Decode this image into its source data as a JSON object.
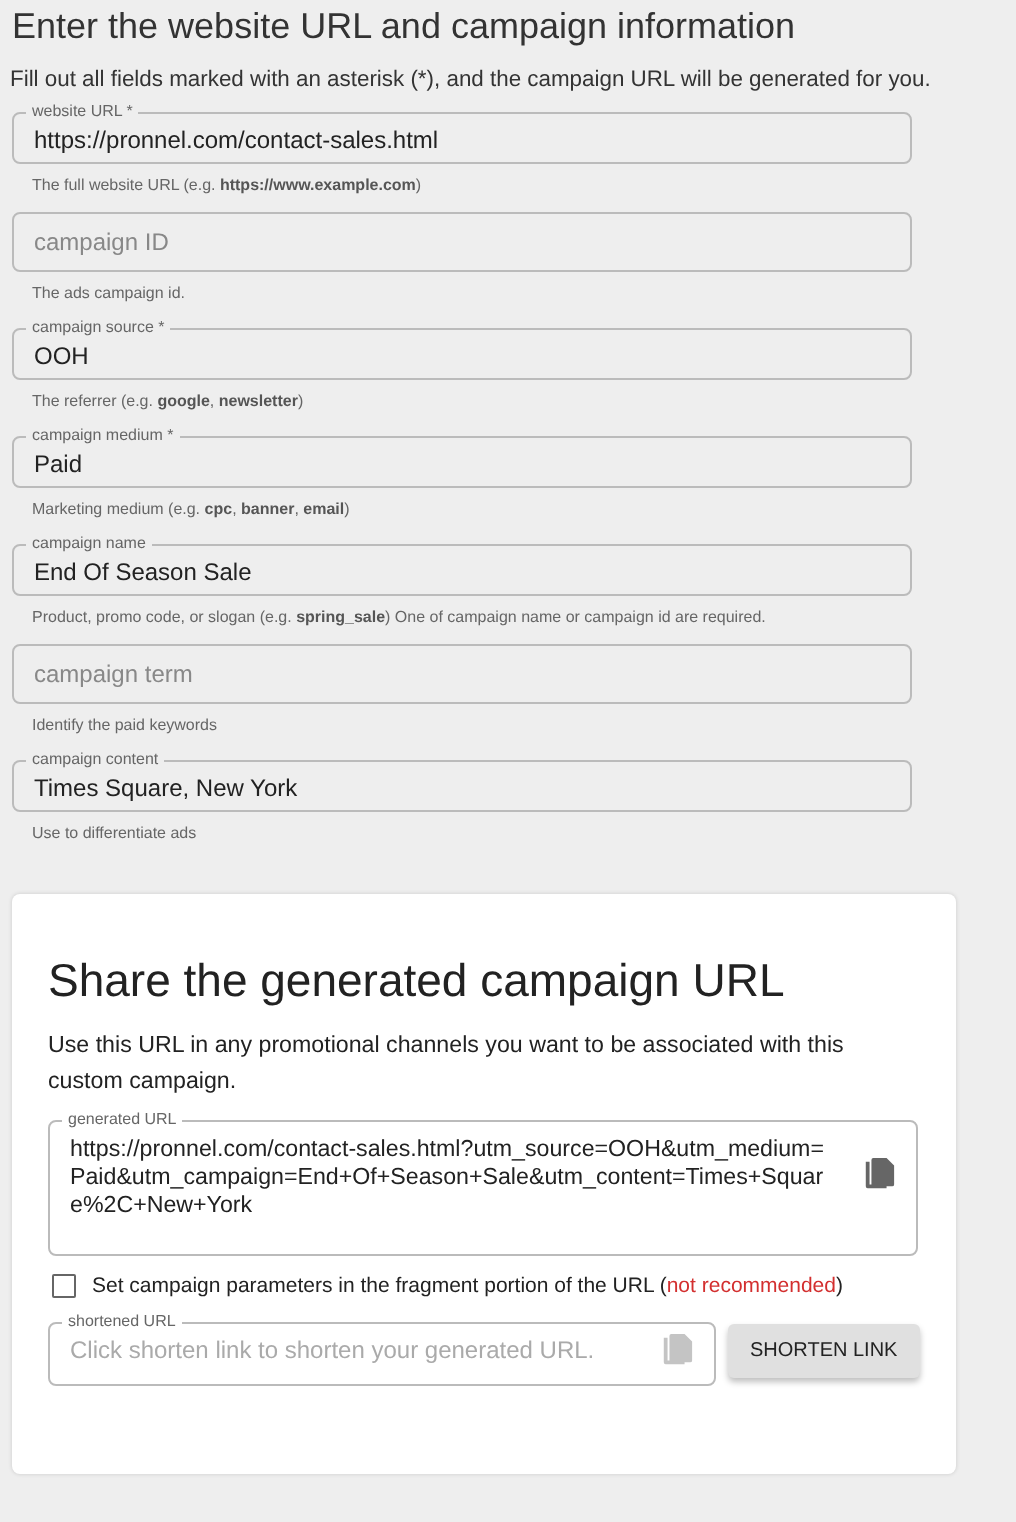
{
  "heading": "Enter the website URL and campaign information",
  "intro": "Fill out all fields marked with an asterisk (*), and the campaign URL will be generated for you.",
  "fields": [
    {
      "label": "website URL *",
      "value": "https://pronnel.com/contact-sales.html",
      "helper": "The full website URL (e.g. **https://www.example.com**)"
    },
    {
      "placeholder": "campaign ID",
      "helper": "The ads campaign id."
    },
    {
      "label": "campaign source *",
      "value": "OOH",
      "helper": "The referrer (e.g. **google**, **newsletter**)"
    },
    {
      "label": "campaign medium *",
      "value": "Paid",
      "helper": "Marketing medium (e.g. **cpc**, **banner**, **email**)"
    },
    {
      "label": "campaign name",
      "value": "End Of Season Sale",
      "helper": "Product, promo code, or slogan (e.g. **spring_sale**) One of campaign name or campaign id are required."
    },
    {
      "placeholder": "campaign term",
      "helper": "Identify the paid keywords"
    },
    {
      "label": "campaign content",
      "value": "Times Square, New York",
      "helper": "Use to differentiate ads"
    }
  ],
  "share": {
    "title": "Share the generated campaign URL",
    "text": "Use this URL in any promotional channels you want to be associated with this custom campaign.",
    "generated": {
      "label": "generated URL",
      "value": "https://pronnel.com/contact-sales.html?utm_source=OOH&utm_medium=Paid&utm_campaign=End+Of+Season+Sale&utm_content=Times+Square%2C+New+York"
    },
    "fragment_option": {
      "checked": false,
      "text_start": "Set campaign parameters in the fragment portion of the URL (",
      "warning": "not recommended",
      "text_end": ")"
    },
    "shortened": {
      "label": "shortened URL",
      "placeholder": "Click shorten link to shorten your generated URL."
    },
    "button": "SHORTEN LINK"
  }
}
